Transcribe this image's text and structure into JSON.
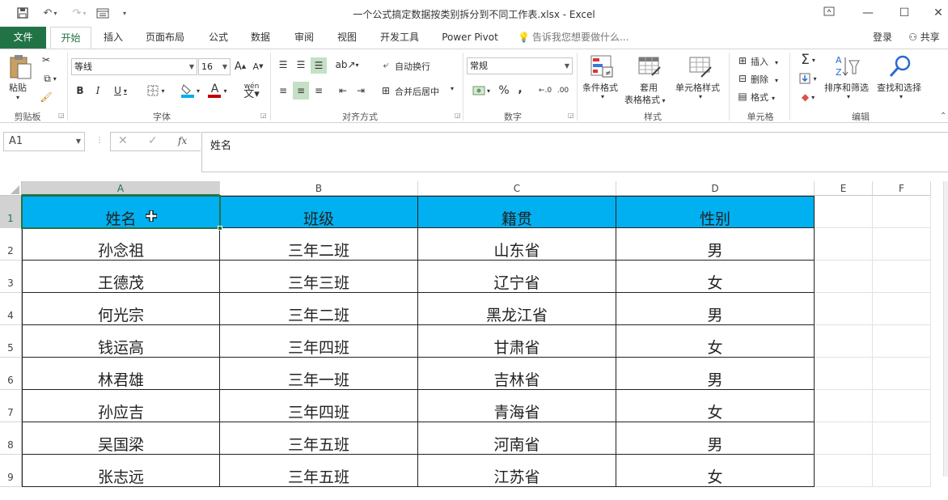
{
  "window": {
    "title": "一个公式搞定数据按类别拆分到不同工作表.xlsx - Excel"
  },
  "tabs": [
    "文件",
    "开始",
    "插入",
    "页面布局",
    "公式",
    "数据",
    "审阅",
    "视图",
    "开发工具",
    "Power Pivot"
  ],
  "tellme": "告诉我您想要做什么...",
  "account": {
    "login": "登录",
    "share": "共享"
  },
  "ribbon": {
    "clipboard": {
      "paste": "粘贴",
      "label": "剪贴板"
    },
    "font": {
      "name": "等线",
      "size": "16",
      "label": "字体",
      "bold": "B",
      "italic": "I",
      "underline": "U",
      "grow": "A",
      "shrink": "A",
      "color_a": "A",
      "wen": "wén"
    },
    "alignment": {
      "wrap": "自动换行",
      "merge": "合并后居中",
      "label": "对齐方式"
    },
    "number": {
      "format": "常规",
      "label": "数字",
      "percent": "%",
      "comma": ","
    },
    "styles": {
      "cond": "条件格式",
      "table1": "套用",
      "table2": "表格格式",
      "cell": "单元格样式",
      "label": "样式"
    },
    "cells": {
      "insert": "插入",
      "delete": "删除",
      "format": "格式",
      "label": "单元格"
    },
    "editing": {
      "sort": "排序和筛选",
      "find": "查找和选择",
      "label": "编辑",
      "sigma": "Σ"
    }
  },
  "formula_bar": {
    "name_box": "A1",
    "value": "姓名",
    "fx": "fx"
  },
  "sheet": {
    "columns": [
      "A",
      "B",
      "C",
      "D",
      "E",
      "F"
    ],
    "rows": [
      "1",
      "2",
      "3",
      "4",
      "5",
      "6",
      "7",
      "8",
      "9"
    ],
    "data": [
      [
        "姓名",
        "班级",
        "籍贯",
        "性别"
      ],
      [
        "孙念祖",
        "三年二班",
        "山东省",
        "男"
      ],
      [
        "王德茂",
        "三年三班",
        "辽宁省",
        "女"
      ],
      [
        "何光宗",
        "三年二班",
        "黑龙江省",
        "男"
      ],
      [
        "钱运高",
        "三年四班",
        "甘肃省",
        "女"
      ],
      [
        "林君雄",
        "三年一班",
        "吉林省",
        "男"
      ],
      [
        "孙应吉",
        "三年四班",
        "青海省",
        "女"
      ],
      [
        "吴国梁",
        "三年五班",
        "河南省",
        "男"
      ],
      [
        "张志远",
        "三年五班",
        "江苏省",
        "女"
      ]
    ]
  },
  "colors": {
    "accent": "#217346",
    "header_fill": "#00b0f0"
  }
}
